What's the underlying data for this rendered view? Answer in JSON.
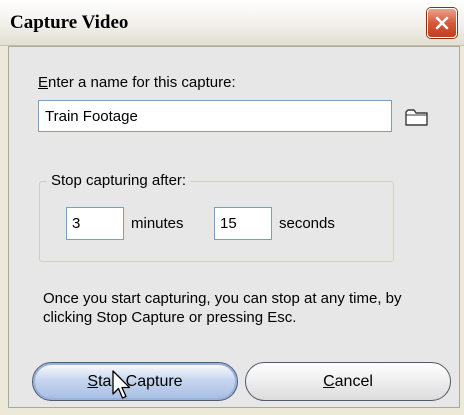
{
  "dialog": {
    "title": "Capture Video"
  },
  "name_section": {
    "label_mnemonic": "E",
    "label_rest": "nter a name for this capture:",
    "value": "Train Footage"
  },
  "stop_section": {
    "legend": "Stop capturing after:",
    "minutes_value": "3",
    "minutes_label": "minutes",
    "seconds_value": "15",
    "seconds_label": "seconds"
  },
  "info": {
    "text": "Once you start capturing, you can stop at any time, by clicking Stop Capture or pressing Esc."
  },
  "buttons": {
    "start_mnemonic": "S",
    "start_rest": "tart Capture",
    "cancel_mnemonic": "C",
    "cancel_rest": "ancel"
  },
  "icons": {
    "close": "close-icon",
    "folder": "folder-icon",
    "cursor": "mouse-pointer-icon"
  },
  "colors": {
    "window_bg": "#ece9d8",
    "close_red": "#d7593b",
    "start_button": "#a7bde3",
    "input_border": "#7f9db9"
  }
}
